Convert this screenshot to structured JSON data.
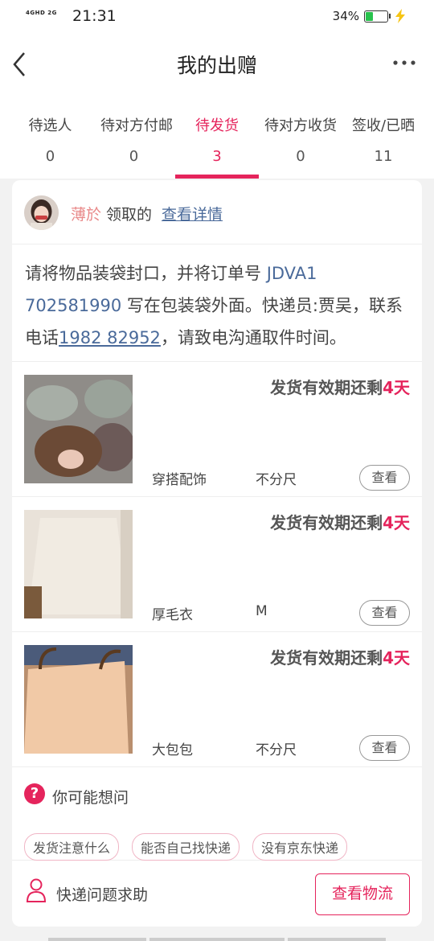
{
  "status_bar": {
    "network": "4GHD 2G",
    "time": "21:31",
    "battery_percent": "34%",
    "battery_level": 0.34,
    "battery_color": "#27c24c"
  },
  "nav": {
    "title": "我的出赠",
    "back_icon": "chevron-left-icon",
    "more_icon": "more-horizontal-icon"
  },
  "tabs": [
    {
      "label": "待选人",
      "count": "0",
      "active": false
    },
    {
      "label": "待对方付邮",
      "count": "0",
      "active": false
    },
    {
      "label": "待发货",
      "count": "3",
      "active": true
    },
    {
      "label": "待对方收货",
      "count": "0",
      "active": false
    },
    {
      "label": "签收/已晒",
      "count": "11",
      "active": false
    }
  ],
  "order": {
    "receiver_name": "薄於",
    "receiver_action": "领取的",
    "detail_link": "查看详情",
    "instruction_prefix": "请将物品装袋封口，并将订单号 ",
    "order_no": "JDVA1 702581990",
    "instruction_mid": " 写在包装袋外面。快递员:贾吴，联系电话",
    "phone": "1982 82952",
    "instruction_suffix": "，请致电沟通取件时间。"
  },
  "items": [
    {
      "deadline_prefix": "发货有效期还剩",
      "deadline_days": "4天",
      "category": "穿搭配饰",
      "size": "不分尺",
      "view_label": "查看"
    },
    {
      "deadline_prefix": "发货有效期还剩",
      "deadline_days": "4天",
      "category": "厚毛衣",
      "size": "M",
      "view_label": "查看"
    },
    {
      "deadline_prefix": "发货有效期还剩",
      "deadline_days": "4天",
      "category": "大包包",
      "size": "不分尺",
      "view_label": "查看"
    }
  ],
  "faq": {
    "icon": "question-circle-icon",
    "title": "你可能想问",
    "chips": [
      "发货注意什么",
      "能否自己找快递",
      "没有京东快递"
    ]
  },
  "help": {
    "icon": "person-icon",
    "text": "快递问题求助",
    "logistics_button": "查看物流"
  },
  "colors": {
    "accent": "#e5245c",
    "link": "#4a6a9a",
    "username": "#e98a8a"
  }
}
